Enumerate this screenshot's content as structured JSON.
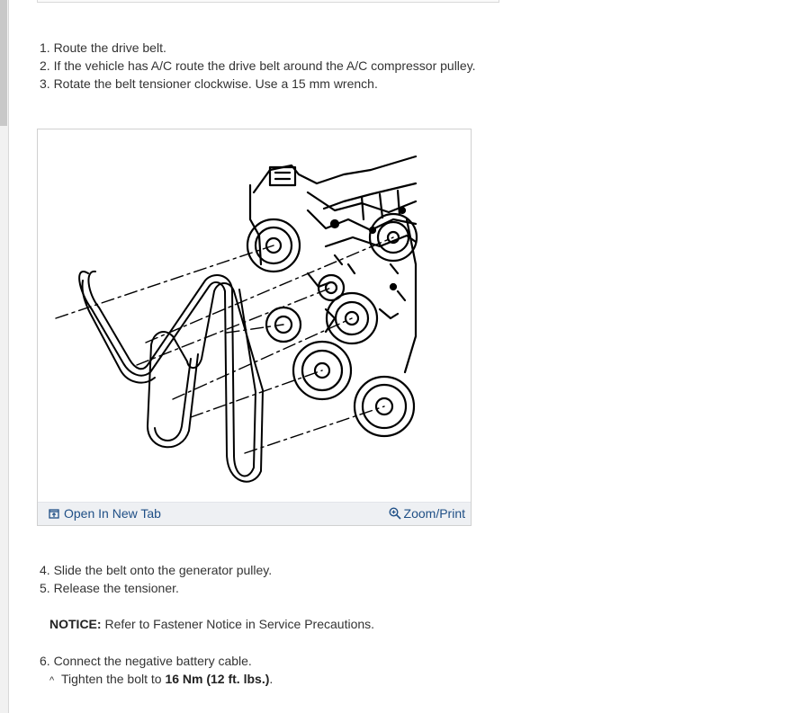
{
  "steps_top": [
    "1. Route the drive belt.",
    "2. If the vehicle has A/C route the drive belt around the A/C compressor pulley.",
    "3. Rotate the belt tensioner clockwise. Use a 15 mm wrench."
  ],
  "figure": {
    "open_tab_label": "Open In New Tab",
    "zoom_print_label": "Zoom/Print",
    "open_tab_icon": "open-in-new-tab-icon",
    "zoom_icon": "magnifier-plus-icon",
    "link_color": "#1f4f86"
  },
  "steps_middle": [
    "4. Slide the belt onto the generator pulley.",
    "5. Release the tensioner."
  ],
  "notice": {
    "label": "NOTICE:",
    "text": " Refer to Fastener Notice in Service Precautions."
  },
  "steps_bottom": [
    "6. Connect the negative battery cable."
  ],
  "sub_step": {
    "caret": "^",
    "prefix": "Tighten the bolt to ",
    "value": "16 Nm (12 ft. lbs.)",
    "suffix": "."
  }
}
